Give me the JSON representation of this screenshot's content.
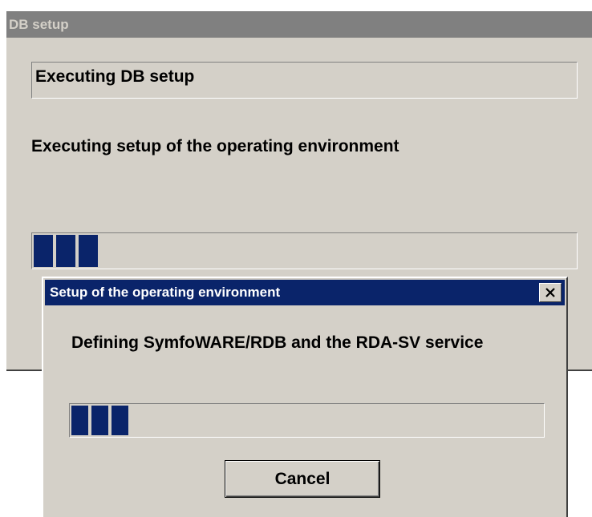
{
  "db_window": {
    "title": "DB setup",
    "status_text": "Executing DB setup",
    "message": "Executing setup of the operating environment",
    "progress": {
      "filled_blocks": 3
    }
  },
  "dialog": {
    "title": "Setup of the operating environment",
    "close_icon": "close-x-icon",
    "message": "Defining SymfoWARE/RDB and the RDA-SV service",
    "progress": {
      "filled_blocks": 3
    },
    "cancel_label": "Cancel"
  },
  "colors": {
    "window_face": "#d4d0c8",
    "inactive_titlebar": "#808080",
    "active_titlebar": "#0a246a",
    "progress_fill": "#0a246a"
  }
}
